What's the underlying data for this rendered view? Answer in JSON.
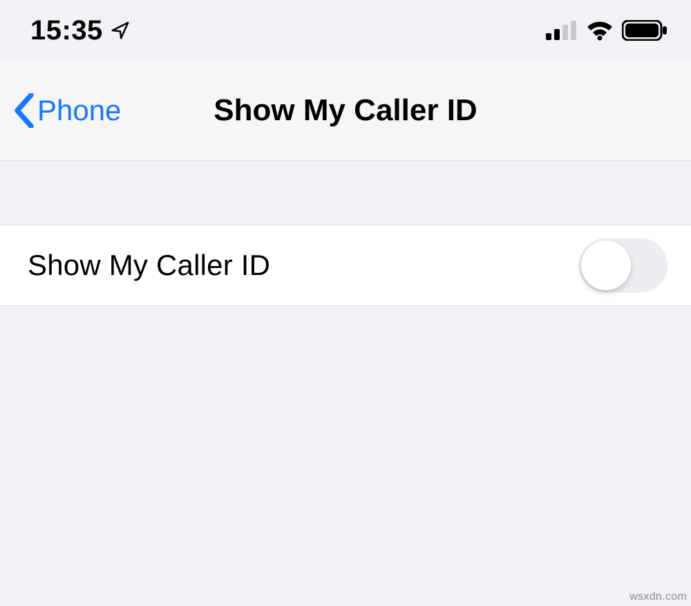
{
  "status": {
    "time": "15:35",
    "location_icon": "location-arrow-icon",
    "signal_icon": "cellular-signal-icon",
    "wifi_icon": "wifi-icon",
    "battery_icon": "battery-full-icon"
  },
  "nav": {
    "back_label": "Phone",
    "back_icon": "chevron-left-icon",
    "title": "Show My Caller ID",
    "accent_color": "#1778ff"
  },
  "settings": {
    "show_caller_id": {
      "label": "Show My Caller ID",
      "value": false
    }
  },
  "watermark": "wsxdn.com"
}
